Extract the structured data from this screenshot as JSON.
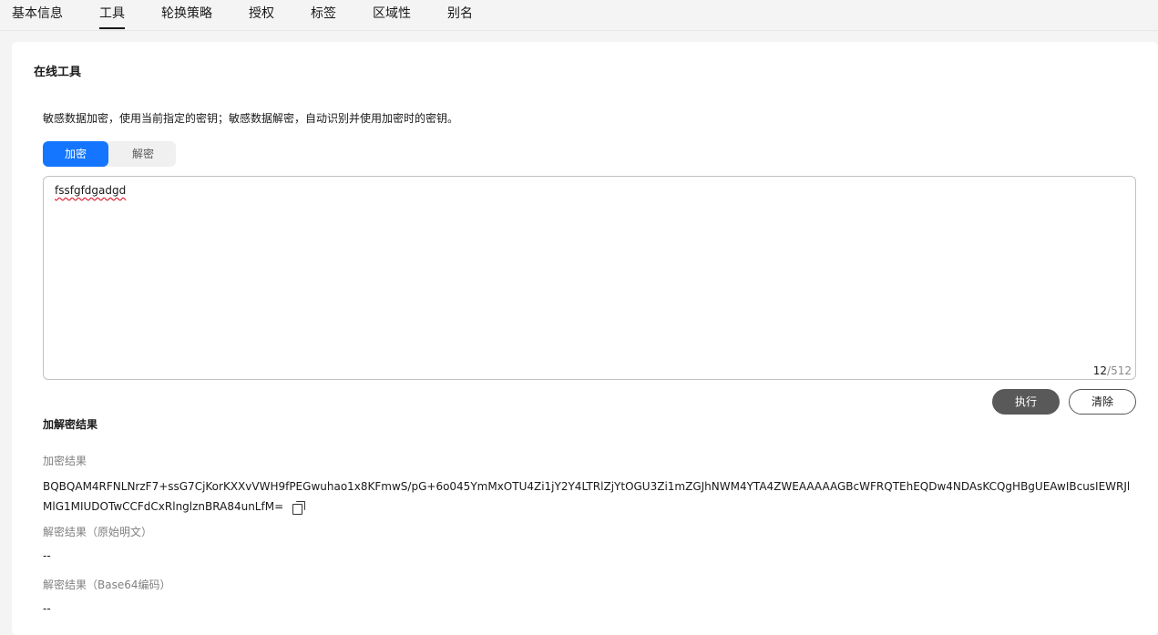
{
  "tabs": [
    {
      "label": "基本信息"
    },
    {
      "label": "工具",
      "active": true
    },
    {
      "label": "轮换策略"
    },
    {
      "label": "授权"
    },
    {
      "label": "标签"
    },
    {
      "label": "区域性"
    },
    {
      "label": "别名"
    }
  ],
  "online_tools": {
    "title": "在线工具",
    "description": "敏感数据加密，使用当前指定的密钥；敏感数据解密，自动识别并使用加密时的密钥。",
    "mode": {
      "encrypt_label": "加密",
      "decrypt_label": "解密",
      "selected": "加密"
    },
    "input": {
      "value": "fssfgfdgadgd",
      "count": "12",
      "max": "/512"
    },
    "actions": {
      "execute_label": "执行",
      "clear_label": "清除"
    }
  },
  "results": {
    "title": "加解密结果",
    "encrypt_label": "加密结果",
    "encrypt_value": "BQBQAM4RFNLNrzF7+ssG7CjKorKXXvVWH9fPEGwuhao1x8KFmwS/pG+6o045YmMxOTU4Zi1jY2Y4LTRlZjYtOGU3Zi1mZGJhNWM4YTA4ZWEAAAAAGBcWFRQTEhEQDw4NDAsKCQgHBgUEAwIBcusIEWRJlMlG1MIUDOTwCCFdCxRlnglznBRA84unLfM=",
    "decrypt_plain_label": "解密结果（原始明文）",
    "decrypt_plain_value": "--",
    "decrypt_base64_label": "解密结果（Base64编码）",
    "decrypt_base64_value": "--"
  },
  "colors": {
    "primary": "#1476ff",
    "execute_bg": "#595959"
  }
}
